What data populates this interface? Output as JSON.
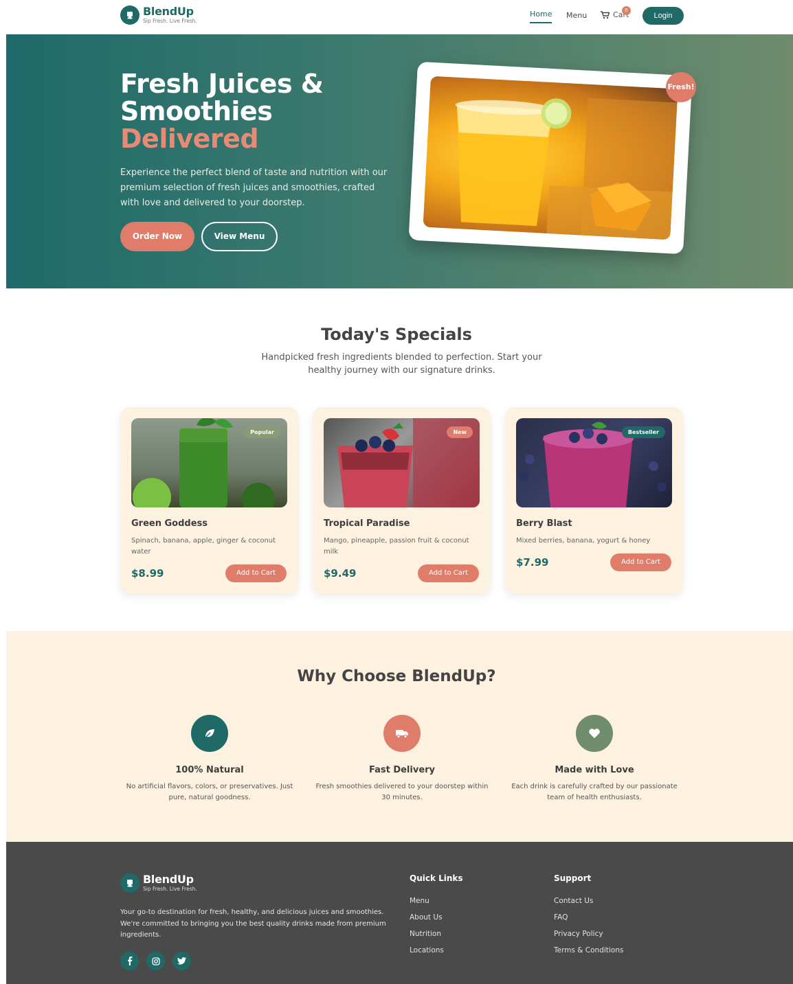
{
  "header": {
    "brand_name": "BlendUp",
    "brand_tagline": "Sip Fresh. Live Fresh.",
    "nav": {
      "home": "Home",
      "menu": "Menu",
      "cart": "Cart",
      "cart_count": "0"
    },
    "login_label": "Login"
  },
  "hero": {
    "title_line1": "Fresh Juices &",
    "title_line2": "Smoothies",
    "title_accent": "Delivered",
    "description": "Experience the perfect blend of taste and nutrition with our premium selection of fresh juices and smoothies, crafted with love and delivered to your doorstep.",
    "order_label": "Order Now",
    "view_label": "View Menu",
    "badge": "Fresh!"
  },
  "specials": {
    "title": "Today's Specials",
    "subtitle": "Handpicked fresh ingredients blended to perfection. Start your healthy journey with our signature drinks.",
    "cards": [
      {
        "badge": "Popular",
        "name": "Green Goddess",
        "desc": "Spinach, banana, apple, ginger & coconut water",
        "price": "$8.99",
        "button": "Add to Cart"
      },
      {
        "badge": "New",
        "name": "Tropical Paradise",
        "desc": "Mango, pineapple, passion fruit & coconut milk",
        "price": "$9.49",
        "button": "Add to Cart"
      },
      {
        "badge": "Bestseller",
        "name": "Berry Blast",
        "desc": "Mixed berries, banana, yogurt & honey",
        "price": "$7.99",
        "button": "Add to Cart"
      }
    ]
  },
  "why": {
    "title": "Why Choose BlendUp?",
    "features": [
      {
        "icon": "leaf-icon",
        "title": "100% Natural",
        "desc": "No artificial flavors, colors, or preservatives. Just pure, natural goodness."
      },
      {
        "icon": "truck-icon",
        "title": "Fast Delivery",
        "desc": "Fresh smoothies delivered to your doorstep within 30 minutes."
      },
      {
        "icon": "heart-icon",
        "title": "Made with Love",
        "desc": "Each drink is carefully crafted by our passionate team of health enthusiasts."
      }
    ]
  },
  "footer": {
    "brand_name": "BlendUp",
    "brand_tagline": "Sip Fresh. Live Fresh.",
    "description": "Your go-to destination for fresh, healthy, and delicious juices and smoothies. We're committed to bringing you the best quality drinks made from premium ingredients.",
    "quick_links_title": "Quick Links",
    "quick_links": [
      "Menu",
      "About Us",
      "Nutrition",
      "Locations"
    ],
    "support_title": "Support",
    "support_links": [
      "Contact Us",
      "FAQ",
      "Privacy Policy",
      "Terms & Conditions"
    ]
  },
  "colors": {
    "primary": "#1f6a66",
    "accent": "#e07c6a",
    "sage": "#6f8c6c",
    "cream": "#fdf1e0",
    "footer": "#4a4a4a"
  }
}
